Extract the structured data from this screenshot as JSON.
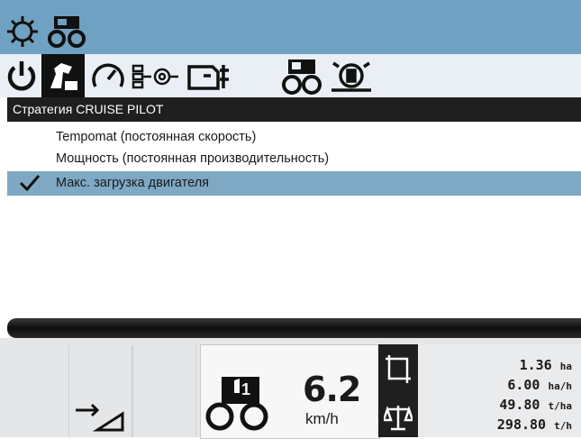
{
  "menu": {
    "title": "Стратегия CRUISE PILOT",
    "items": [
      {
        "label": "Tempomat (постоянная скорость)",
        "selected": false
      },
      {
        "label": "Мощность (постоянная производительность)",
        "selected": false
      },
      {
        "label": "Макс. загрузка двигателя",
        "selected": true
      }
    ]
  },
  "speed": {
    "value": "6.2",
    "unit": "km/h"
  },
  "stats": [
    {
      "value": "1.36",
      "unit": "ha"
    },
    {
      "value": "6.00",
      "unit": "ha/h"
    },
    {
      "value": "49.80",
      "unit": "t/ha"
    },
    {
      "value": "298.80",
      "unit": "t/h"
    }
  ],
  "icons": {
    "top": [
      "gear-icon",
      "tractor-icon"
    ],
    "toolbar": [
      "power-icon",
      "cruise-pilot-icon",
      "speedometer-icon",
      "gearbox-icon",
      "engine-icon",
      "tractor-settings-icon",
      "tire-pressure-icon"
    ],
    "bottom": [
      "implement-depth-icon",
      "tractor-1-icon",
      "field-area-icon",
      "weighing-scale-icon"
    ]
  },
  "colors": {
    "topbar": "#6fa1c2",
    "selection": "#7fa8c4",
    "title_bg": "#1f1f1f"
  }
}
